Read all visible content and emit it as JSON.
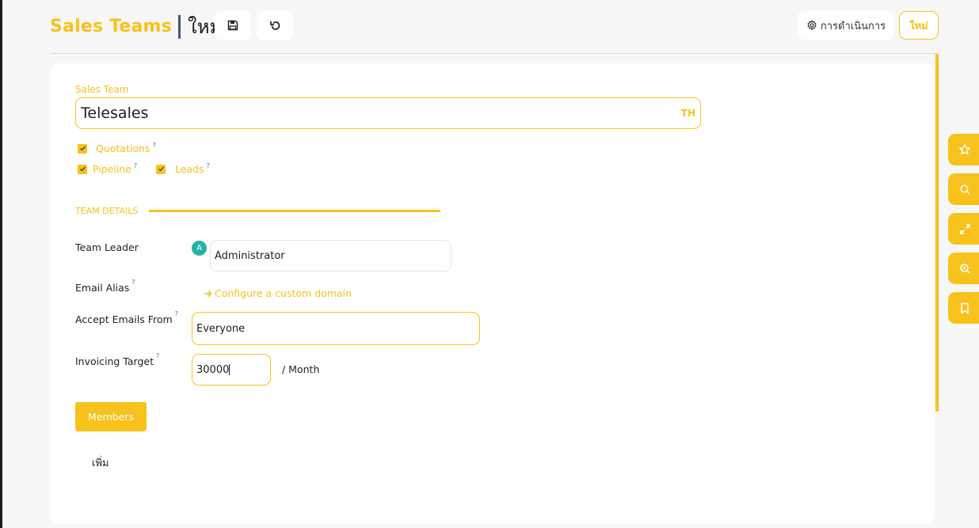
{
  "breadcrumb": {
    "parent": "Sales Teams",
    "current": "ใหม่"
  },
  "header": {
    "save_icon": "save-icon",
    "discard_icon": "undo-icon",
    "actions_label": "การดำเนินการ",
    "new_label": "ใหม่"
  },
  "form": {
    "name_label": "Sales Team",
    "name_value": "Telesales",
    "lang_tag": "TH",
    "checkboxes": [
      {
        "label": "Quotations",
        "help": "?",
        "checked": true
      },
      {
        "label": "Pipeline",
        "help": "?",
        "checked": true
      },
      {
        "label": "Leads",
        "help": "?",
        "checked": true
      }
    ],
    "section_title": "TEAM DETAILS",
    "team_leader_label": "Team Leader",
    "team_leader_avatar": "A",
    "team_leader_value": "Administrator",
    "email_alias_label": "Email Alias",
    "email_alias_help": "?",
    "configure_domain_link": "Configure a custom domain",
    "accept_emails_label": "Accept Emails From",
    "accept_emails_help": "?",
    "accept_emails_value": "Everyone",
    "invoicing_target_label": "Invoicing Target",
    "invoicing_target_help": "?",
    "invoicing_target_value": "30000",
    "per_month": "/ Month"
  },
  "tabs": {
    "members": "Members"
  },
  "members": {
    "add_line": "เพิ่ม"
  },
  "sidebar_tools": [
    "star-icon",
    "search-icon",
    "expand-icon",
    "zoom-in-icon",
    "bookmark-icon"
  ],
  "colors": {
    "accent": "#f7c21b",
    "avatar": "#27b1a8",
    "help": "#2f7db3"
  }
}
